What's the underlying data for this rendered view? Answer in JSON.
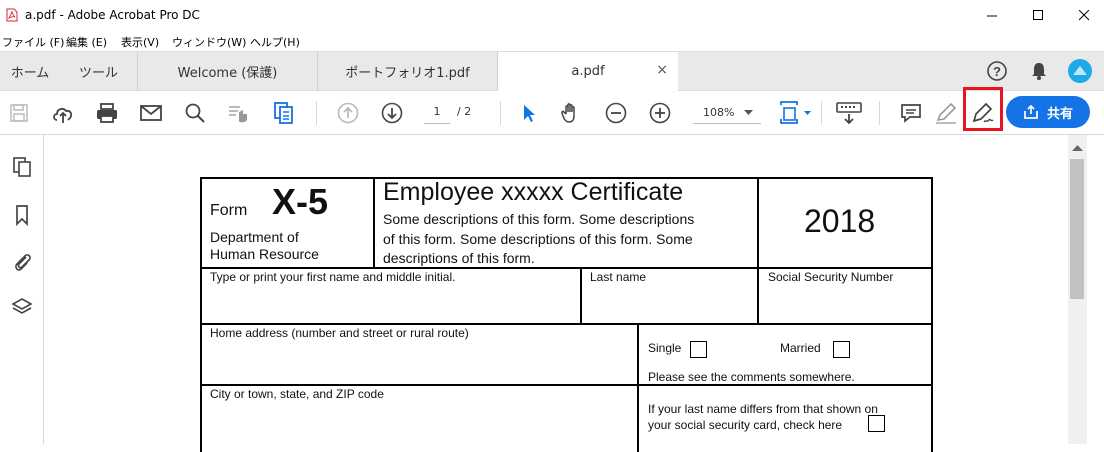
{
  "window": {
    "title": "a.pdf - Adobe Acrobat Pro DC",
    "minimize": "—",
    "maximize": "☐",
    "close": "✕"
  },
  "menu": [
    "ファイル (F)",
    "編集 (E)",
    "表示(V)",
    "ウィンドウ(W)",
    "ヘルプ(H)"
  ],
  "tabs": {
    "home": "ホーム",
    "tools": "ツール",
    "doc1": "Welcome (保護)",
    "doc2": "ポートフォリオ1.pdf",
    "doc3": "a.pdf",
    "close": "×"
  },
  "toolbar": {
    "page_current": "1",
    "page_total": "/ 2",
    "zoom": "108%",
    "share_label": "共有",
    "highlighted_tool": "sign-pen-icon",
    "highlight_color": "#e8141e"
  },
  "colors": {
    "accent": "#1473e6",
    "selected_tool": "#1473e6"
  },
  "form": {
    "form_word": "Form",
    "form_number": "X-5",
    "dept_line1": "Department of",
    "dept_line2": "Human Resource",
    "title": "Employee xxxxx Certificate",
    "desc_line1": "Some descriptions of this form. Some descriptions",
    "desc_line2": "of this form. Some descriptions of this form. Some",
    "desc_line3": "descriptions of this form.",
    "year": "2018",
    "first_name_label": "Type or print your first name and middle initial.",
    "last_name_label": "Last name",
    "ssn_label": "Social Security Number",
    "address_label": "Home address (number and street or rural route)",
    "single_label": "Single",
    "married_label": "Married",
    "comments_note": "Please see the comments somewhere.",
    "city_label": "City or town, state, and ZIP code",
    "name_differs_line1": "If your last name differs from that shown on",
    "name_differs_line2": "your social security card, check here"
  }
}
